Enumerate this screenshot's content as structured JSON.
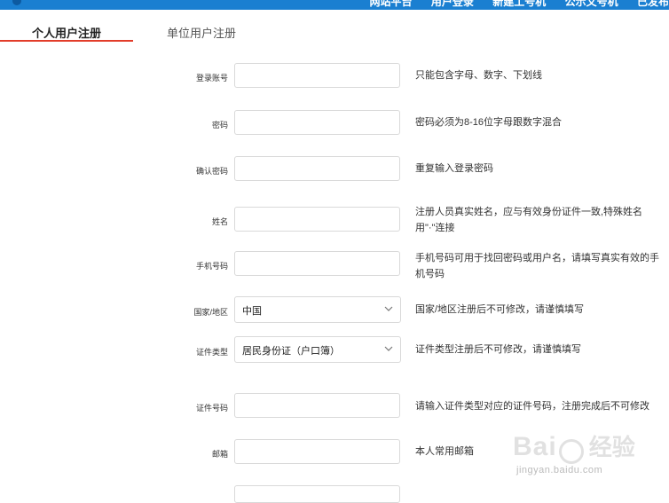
{
  "top_nav": {
    "items": [
      "网站平台",
      "用户登录",
      "新建工号机",
      "公示文号机",
      "已发布"
    ]
  },
  "tabs": {
    "personal": "个人用户注册",
    "organization": "单位用户注册"
  },
  "form": {
    "login_label": "登录账号",
    "login_hint": "只能包含字母、数字、下划线",
    "password_label": "密码",
    "password_hint": "密码必须为8-16位字母跟数字混合",
    "confirm_label": "确认密码",
    "confirm_hint": "重复输入登录密码",
    "name_label": "姓名",
    "name_hint_1": "注册人员真实姓名，应与有效身份证件一致,特殊姓名",
    "name_hint_2": "用\"·\"连接",
    "phone_label": "手机号码",
    "phone_hint_1": "手机号码可用于找回密码或用户名，请填写真实有效的手",
    "phone_hint_2": "机号码",
    "country_label": "国家/地区",
    "country_value": "中国",
    "country_hint": "国家/地区注册后不可修改，请谨慎填写",
    "idtype_label": "证件类型",
    "idtype_value": "居民身份证（户口簿）",
    "idtype_hint": "证件类型注册后不可修改，请谨慎填写",
    "idnum_label": "证件号码",
    "idnum_hint": "请输入证件类型对应的证件号码，注册完成后不可修改",
    "email_label": "邮箱",
    "email_hint": "本人常用邮箱"
  },
  "watermark": {
    "brand_left": "Bai",
    "brand_right": "经验",
    "url": "jingyan.baidu.com"
  },
  "colors": {
    "accent": "#1a7fd1",
    "tab_underline": "#e23c2a",
    "border": "#d9d9d9"
  }
}
